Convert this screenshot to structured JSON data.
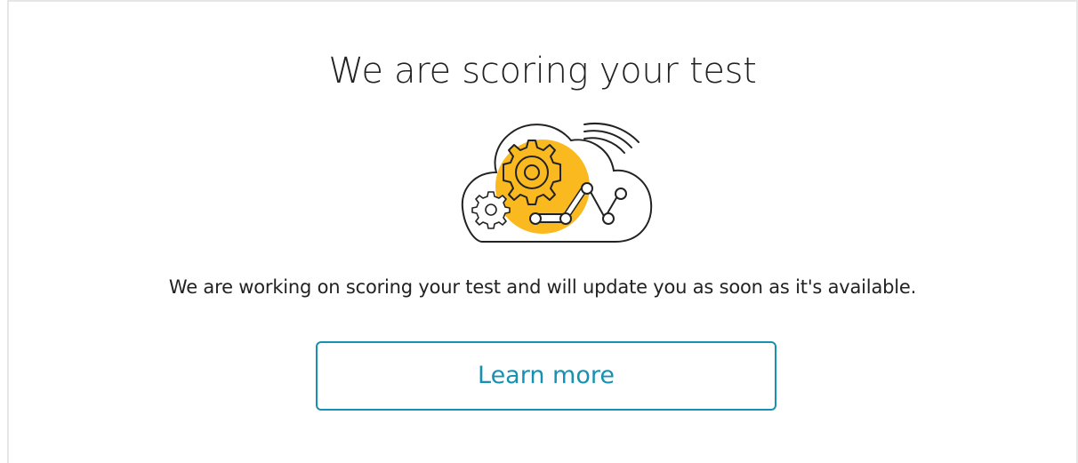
{
  "page": {
    "title": "We are scoring your test",
    "message": "We are working on scoring your test and will update you as soon as it's available.",
    "learn_more_label": "Learn more"
  },
  "illustration": {
    "icon": "cloud-gears-chart-icon",
    "accent_color": "#f9b91f"
  },
  "colors": {
    "button_accent": "#1791b2",
    "text": "#222222",
    "border": "#e6e6e6"
  }
}
